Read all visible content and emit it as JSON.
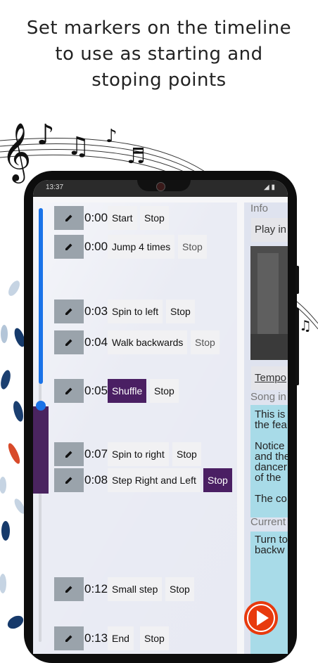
{
  "headline": {
    "line1": "Set markers on the timeline",
    "line2": "to use as starting and",
    "line3": "stoping points"
  },
  "status_bar": {
    "time": "13:37",
    "icons": "◢ ▮"
  },
  "markers": [
    {
      "time": "0:00",
      "label": "Start",
      "stop": "Stop",
      "active": false
    },
    {
      "time": "0:00",
      "label": "Jump 4 times",
      "stop": "Stop",
      "active": false
    },
    {
      "time": "0:03",
      "label": "Spin to left",
      "stop": "Stop",
      "active": false
    },
    {
      "time": "0:04",
      "label": "Walk backwards",
      "stop": "Stop",
      "active": false
    },
    {
      "time": "0:05",
      "label": "Shuffle",
      "stop": "Stop",
      "active": true
    },
    {
      "time": "0:07",
      "label": "Spin to right",
      "stop": "Stop",
      "active": false
    },
    {
      "time": "0:08",
      "label": "Step Right and Left",
      "stop": "Stop",
      "active_stop": true
    },
    {
      "time": "0:12",
      "label": "Small step",
      "stop": "Stop",
      "active": false
    },
    {
      "time": "0:13",
      "label": "End",
      "stop": "Stop",
      "active": false
    }
  ],
  "side_panel": {
    "info_label": "Info",
    "play_button": "Play in",
    "tempo_button": "Tempo",
    "song_info_label": "Song in",
    "song_info_lines": [
      "This is",
      "the fea",
      "",
      "Notice",
      "and the",
      "dancer",
      "of the",
      "",
      "The co"
    ],
    "current_label": "Current",
    "current_lines": [
      "Turn to",
      "backw"
    ]
  },
  "colors": {
    "accent": "#1a73e8",
    "active": "#4a1f63",
    "play": "#e83a0d",
    "info_box": "#a8dbe8"
  },
  "icons": {
    "edit": "pencil-icon",
    "play": "play-icon"
  }
}
